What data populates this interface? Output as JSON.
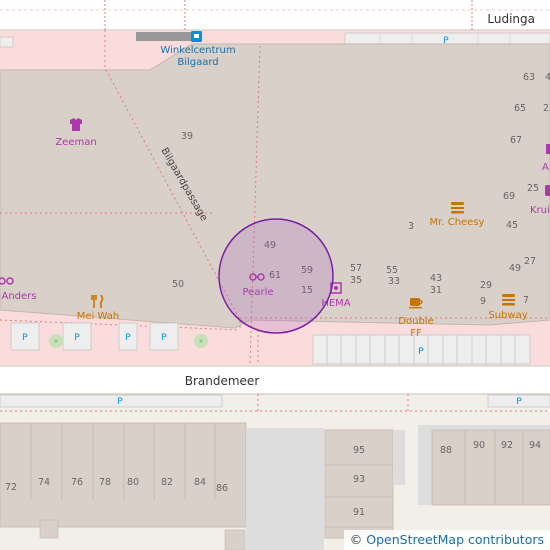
{
  "streets": {
    "top": "Ludinga",
    "middle": "Brandemeer",
    "path": "Bilgaardpassage"
  },
  "mall": {
    "name_line1": "Winkelcentrum",
    "name_line2": "Bilgaard"
  },
  "pois": {
    "zeeman": "Zeeman",
    "mr_cheesy": "Mr. Cheesy",
    "anders": "Anders",
    "mei_wah": "Mei Wah",
    "pearle": "Pearle",
    "hema": "HEMA",
    "double_ff_line1": "Double",
    "double_ff_line2": "FF",
    "subway": "Subway",
    "kruidvat_partial": "Kruid",
    "partial_a": "A"
  },
  "parking_symbol": "P",
  "house_numbers": {
    "n63": "63",
    "n65": "65",
    "n67": "67",
    "n69": "69",
    "n25": "25",
    "n45": "45",
    "n27": "27",
    "n49b": "49",
    "n29": "29",
    "n7": "7",
    "n9": "9",
    "n39": "39",
    "n3": "3",
    "n49": "49",
    "n61": "61",
    "n59": "59",
    "n15": "15",
    "n50": "50",
    "n57": "57",
    "n35": "35",
    "n55": "55",
    "n33": "33",
    "n43": "43",
    "n31": "31",
    "n95": "95",
    "n93": "93",
    "n91": "91",
    "n72": "72",
    "n74": "74",
    "n76": "76",
    "n78": "78",
    "n80": "80",
    "n82": "82",
    "n84": "84",
    "n86": "86",
    "n88": "88",
    "n90": "90",
    "n92": "92",
    "n94": "94",
    "n2partial": "2",
    "n4partial": "4"
  },
  "attribution": {
    "symbol": "©",
    "text": "OpenStreetMap contributors"
  },
  "colors": {
    "background": "#f2efe9",
    "pedestrian": "#fadcdc",
    "building": "#d9d0c9",
    "building_outline": "#c4b6ab",
    "road": "#ffffff",
    "poi_shop": "#ac39ac",
    "poi_food": "#c77400",
    "accuracy_circle": "#7b1fa2",
    "label_text": "#333333",
    "number_text": "#666666",
    "parking_blue": "#0092da",
    "grass": "#c8e0b8"
  }
}
